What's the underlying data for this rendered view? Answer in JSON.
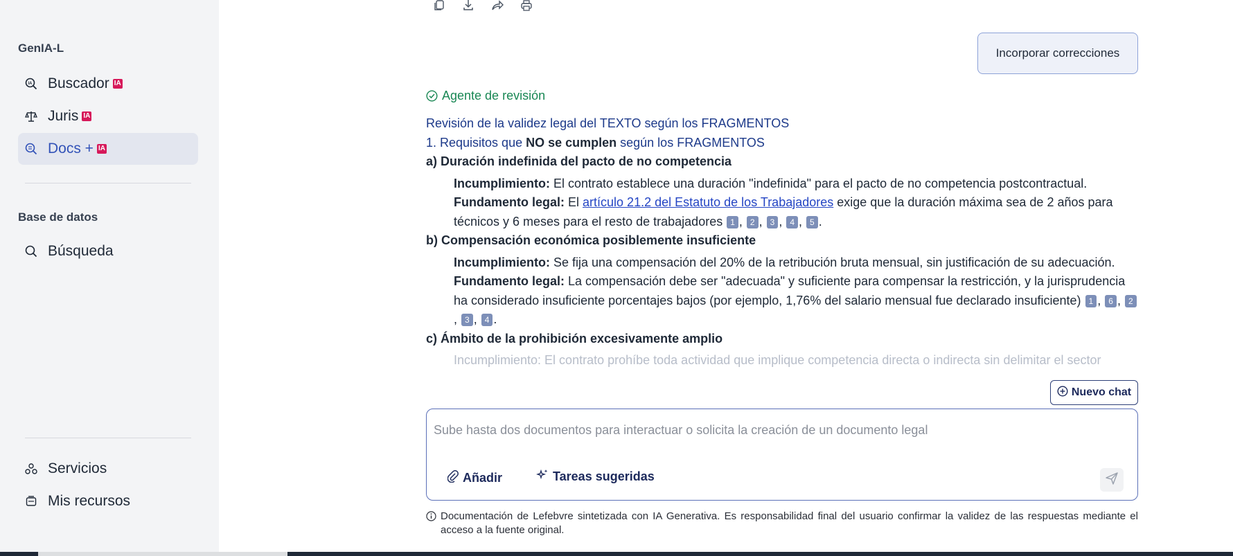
{
  "sidebar": {
    "brand": "GenIA-L",
    "items": [
      {
        "label": "Buscador",
        "badge": "IA",
        "icon": "ia-search-icon"
      },
      {
        "label": "Juris",
        "badge": "IA",
        "icon": "scales-icon"
      },
      {
        "label": "Docs +",
        "badge": "IA",
        "icon": "doc-search-icon",
        "active": true
      }
    ],
    "section_title": "Base de datos",
    "db_items": [
      {
        "label": "Búsqueda",
        "icon": "search-icon"
      }
    ],
    "bottom_items": [
      {
        "label": "Servicios",
        "icon": "services-icon"
      },
      {
        "label": "Mis recursos",
        "icon": "resources-icon"
      }
    ]
  },
  "toolbar": {
    "icons": [
      "copy-icon",
      "download-icon",
      "share-icon",
      "print-icon"
    ]
  },
  "incorporar_label": "Incorporar correcciones",
  "agent_label": "Agente de revisión",
  "content": {
    "heading": "Revisión de la validez legal del TEXTO según los FRAGMENTOS",
    "req_prefix": "1. Requisitos que ",
    "req_bold": "NO se cumplen",
    "req_suffix": " según los FRAGMENTOS",
    "a_title": "a) Duración indefinida del pacto de no competencia",
    "a_inc_label": "Incumplimiento:",
    "a_inc_text": " El contrato establece una duración \"indefinida\" para el pacto de no competencia postcontractual.",
    "a_fund_label": "Fundamento legal:",
    "a_fund_pre": " El ",
    "a_fund_link": "artículo 21.2 del Estatuto de los Trabajadores",
    "a_fund_post": " exige que la duración máxima sea de 2 años para técnicos y 6 meses para el resto de trabajadores ",
    "a_cites": [
      "1",
      "2",
      "3",
      "4",
      "5"
    ],
    "b_title": "b) Compensación económica posiblemente insuficiente",
    "b_inc_label": "Incumplimiento:",
    "b_inc_text": " Se fija una compensación del 20% de la retribución bruta mensual, sin justificación de su adecuación.",
    "b_fund_label": "Fundamento legal:",
    "b_fund_text": " La compensación debe ser \"adecuada\" y suficiente para compensar la restricción, y la jurisprudencia ha considerado insuficiente porcentajes bajos (por ejemplo, 1,76% del salario mensual fue declarado insuficiente) ",
    "b_cites": [
      "1",
      "6",
      "2",
      "3",
      "4"
    ],
    "c_title": "c) Ámbito de la prohibición excesivamente amplio",
    "c_faded": "Incumplimiento: El contrato prohíbe toda actividad que implique competencia directa o indirecta sin delimitar el sector"
  },
  "nuevo_chat_label": "Nuevo chat",
  "input": {
    "placeholder": "Sube hasta dos documentos para interactuar o solicita la creación de un documento legal",
    "value": "",
    "add_label": "Añadir",
    "tasks_label": "Tareas sugeridas"
  },
  "disclaimer": "Documentación de Lefebvre sintetizada con IA Generativa. Es responsabilidad final del usuario confirmar la validez de las respuestas mediante el acceso a la fuente original."
}
